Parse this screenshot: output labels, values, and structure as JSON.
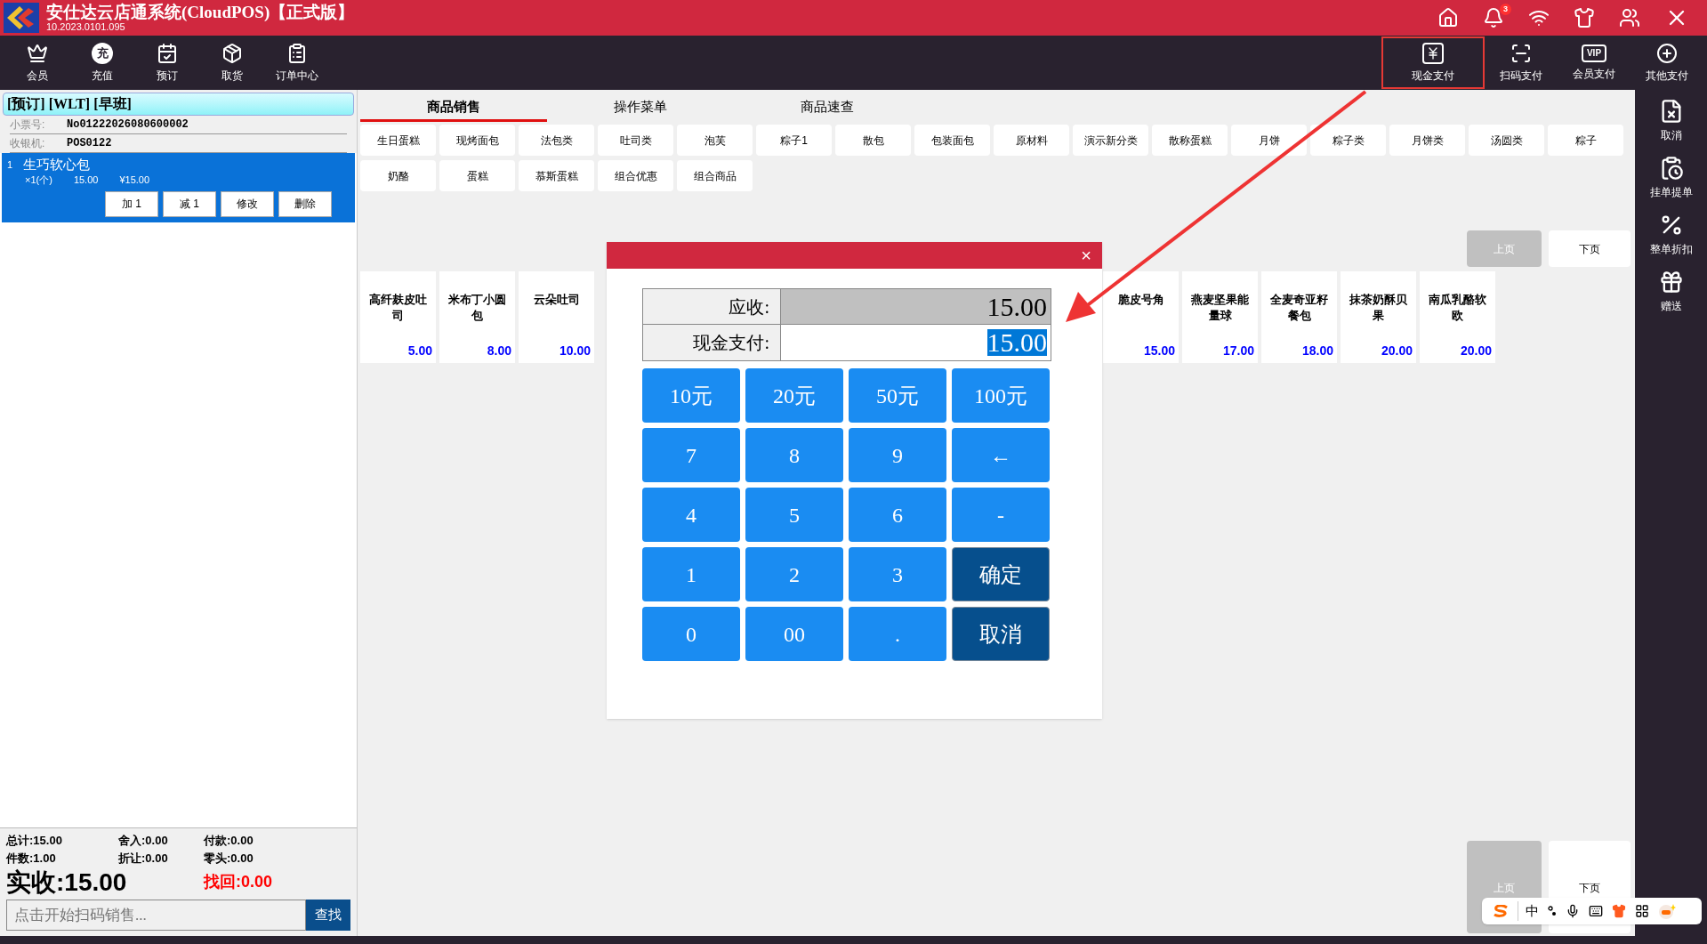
{
  "title_bar": {
    "title": "安仕达云店通系统(CloudPOS)【正式版】",
    "version": "10.2023.0101.095",
    "notification_count": "3"
  },
  "toolbar": {
    "left": [
      {
        "label": "会员",
        "kind": "crown"
      },
      {
        "label": "充值",
        "kind": "glyph",
        "glyph": "充"
      },
      {
        "label": "预订",
        "kind": "calendar"
      },
      {
        "label": "取货",
        "kind": "package"
      },
      {
        "label": "订单中心",
        "kind": "clipboard"
      }
    ],
    "right": [
      {
        "label": "现金支付",
        "kind": "cash",
        "highlighted": true
      },
      {
        "label": "扫码支付",
        "kind": "scan",
        "highlighted": false
      },
      {
        "label": "会员支付",
        "kind": "vip",
        "glyph": "VIP",
        "highlighted": false
      },
      {
        "label": "其他支付",
        "kind": "other",
        "highlighted": false
      }
    ]
  },
  "order": {
    "header": "[预订] [WLT] [早班]",
    "ticket_label": "小票号:",
    "ticket_no": "No01222026080600002",
    "register_label": "收银机:",
    "register": "POS0122",
    "items": [
      {
        "index": "1",
        "name": "生巧软心包",
        "qty": "×1(个)",
        "price": "15.00",
        "amount": "¥15.00",
        "selected": true,
        "actions": [
          "加 1",
          "减 1",
          "修改",
          "删除"
        ]
      }
    ],
    "totals": [
      {
        "text": "总计:15.00"
      },
      {
        "text": "舍入:0.00"
      },
      {
        "text": "付款:0.00"
      },
      {
        "text": "件数:1.00"
      },
      {
        "text": "折让:0.00"
      },
      {
        "text": "零头:0.00"
      }
    ],
    "received": "实收:15.00",
    "change": "找回:0.00",
    "scan_placeholder": "点击开始扫码销售...",
    "search_button": "查找"
  },
  "tabs": [
    {
      "label": "商品销售",
      "selected": true
    },
    {
      "label": "操作菜单",
      "selected": false
    },
    {
      "label": "商品速查",
      "selected": false
    }
  ],
  "categories": [
    "生日蛋糕",
    "现烤面包",
    "法包类",
    "吐司类",
    "泡芙",
    "粽子1",
    "散包",
    "包装面包",
    "原材料",
    "演示新分类",
    "散称蛋糕",
    "月饼",
    "粽子类",
    "月饼类",
    "汤圆类",
    "粽子",
    "奶酪",
    "蛋糕",
    "慕斯蛋糕",
    "组合优惠",
    "组合商品"
  ],
  "products_left": [
    {
      "name": "高纤麸皮吐司",
      "price": "5.00"
    },
    {
      "name": "米布丁小圆包",
      "price": "8.00"
    },
    {
      "name": "云朵吐司",
      "price": "10.00"
    }
  ],
  "products_right": [
    {
      "name": "脆皮号角",
      "price": "15.00"
    },
    {
      "name": "燕麦坚果能量球",
      "price": "17.00"
    },
    {
      "name": "全麦奇亚籽餐包",
      "price": "18.00"
    },
    {
      "name": "抹茶奶酥贝果",
      "price": "20.00"
    },
    {
      "name": "南瓜乳酪软欧",
      "price": "20.00"
    }
  ],
  "pager_top": [
    {
      "label": "上页",
      "disabled": true
    },
    {
      "label": "下页",
      "disabled": false
    }
  ],
  "pager_bottom": [
    {
      "label": "上页",
      "disabled": true
    },
    {
      "label": "下页",
      "disabled": false
    }
  ],
  "dialog": {
    "close": "×",
    "receivable_label": "应收:",
    "receivable": "15.00",
    "cash_label": "现金支付:",
    "cash_value": "15.00",
    "value_selected": true,
    "keys": [
      {
        "label": "10元",
        "kind": "digit"
      },
      {
        "label": "20元",
        "kind": "digit"
      },
      {
        "label": "50元",
        "kind": "digit"
      },
      {
        "label": "100元",
        "kind": "digit"
      },
      {
        "label": "7",
        "kind": "digit"
      },
      {
        "label": "8",
        "kind": "digit"
      },
      {
        "label": "9",
        "kind": "digit"
      },
      {
        "label": "←",
        "kind": "digit"
      },
      {
        "label": "4",
        "kind": "digit"
      },
      {
        "label": "5",
        "kind": "digit"
      },
      {
        "label": "6",
        "kind": "digit"
      },
      {
        "label": "-",
        "kind": "digit"
      },
      {
        "label": "1",
        "kind": "digit"
      },
      {
        "label": "2",
        "kind": "digit"
      },
      {
        "label": "3",
        "kind": "digit"
      },
      {
        "label": "确定",
        "kind": "action"
      },
      {
        "label": "0",
        "kind": "digit"
      },
      {
        "label": "00",
        "kind": "digit"
      },
      {
        "label": ".",
        "kind": "digit"
      },
      {
        "label": "取消",
        "kind": "action"
      }
    ]
  },
  "side_actions": [
    {
      "label": "取消",
      "kind": "cancel"
    },
    {
      "label": "挂单提单",
      "kind": "hold"
    },
    {
      "label": "整单折扣",
      "kind": "discount"
    },
    {
      "label": "赠送",
      "kind": "gift"
    }
  ],
  "ime": {
    "mode": "中"
  }
}
